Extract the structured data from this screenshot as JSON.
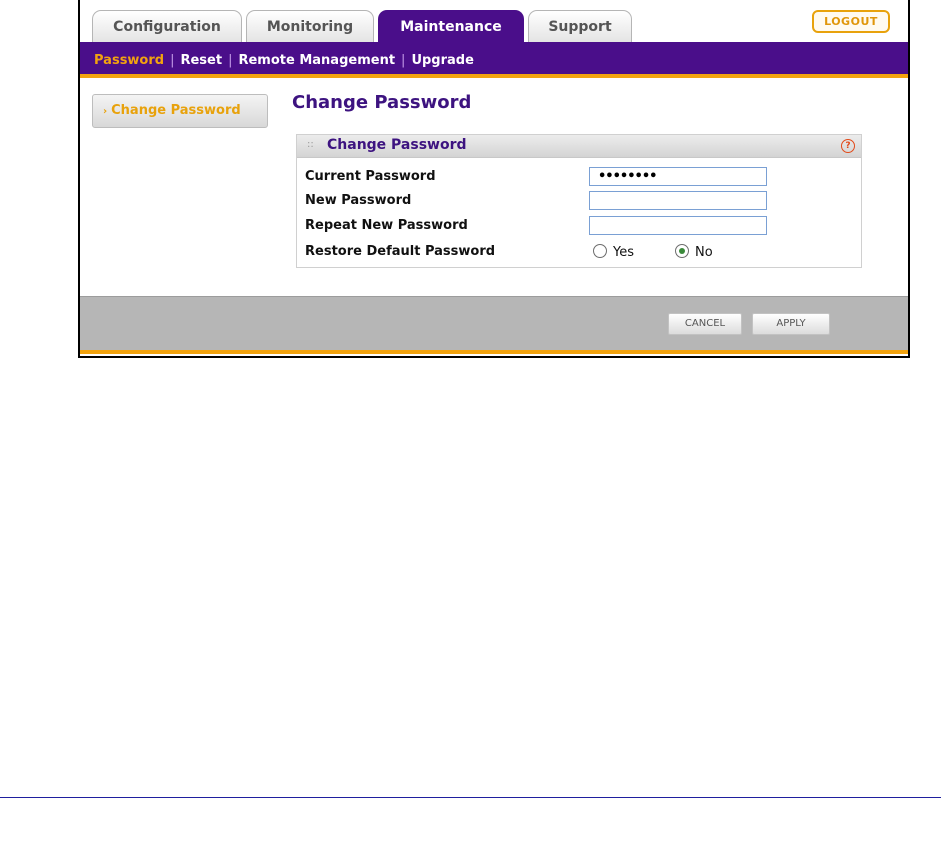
{
  "tabs": [
    {
      "label": "Configuration",
      "active": false
    },
    {
      "label": "Monitoring",
      "active": false
    },
    {
      "label": "Maintenance",
      "active": true
    },
    {
      "label": "Support",
      "active": false
    }
  ],
  "logout_label": "LOGOUT",
  "subnav": {
    "items": [
      "Password",
      "Reset",
      "Remote Management",
      "Upgrade"
    ],
    "current": "Password"
  },
  "sidebar": {
    "item_label": "Change Password",
    "arrow_icon": "chevron-right-icon"
  },
  "page_title": "Change Password",
  "panel": {
    "title": "Change Password",
    "help_icon": "help-icon",
    "current_password_label": "Current Password",
    "current_password_value": "••••••••",
    "new_password_label": "New Password",
    "new_password_value": "",
    "repeat_password_label": "Repeat New Password",
    "repeat_password_value": "",
    "restore_label": "Restore Default Password",
    "restore_options": [
      {
        "label": "Yes",
        "selected": false
      },
      {
        "label": "No",
        "selected": true
      }
    ]
  },
  "buttons": {
    "cancel": "CANCEL",
    "apply": "APPLY"
  },
  "colors": {
    "brand_purple": "#4a0e8a",
    "accent_orange": "#f2a30f"
  }
}
